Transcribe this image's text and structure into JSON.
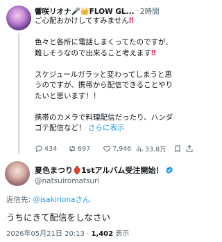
{
  "tweet1": {
    "author": "響咲リオナ🎤👑FLOW GL...",
    "dot": "·",
    "time": "2時間",
    "lines": [
      "ご心配おかけしてすみません",
      "",
      "色々と各所に電話しまくってたのですが、",
      "難しそうなので出来ること考えます",
      "",
      "スケジュールガラッと変わってしまうと思",
      "うのですが、携帯から配信できることやり",
      "たいと思います！！",
      "",
      "携帯のカメラで料理配信だったり、ハンダ",
      "ゴテ配信など！"
    ],
    "show_more": "さらに表示",
    "stats": {
      "replies": "434",
      "retweets": "697",
      "likes": "7,946",
      "views": "33.8万"
    }
  },
  "tweet2": {
    "author": "夏色まつり",
    "author_suffix": "1stアルバム受注開始！",
    "handle": "@natsuiromatsuri",
    "reply_prefix": "返信先: ",
    "reply_mention": "@isakirionaさん",
    "text": "うちにきて配信をしなさい",
    "timestamp": "2026年05月21日 20:13 · ",
    "views_count": "1,402",
    "views_label": " 表示"
  },
  "icons": {
    "reply": "reply-icon",
    "retweet": "retweet-icon",
    "like": "heart-icon",
    "views": "views-icon",
    "bookmark": "bookmark-icon",
    "share": "share-icon",
    "verified": "verified-badge-icon",
    "lantern": "lantern-icon",
    "exclamation": "double-exclamation-icon"
  },
  "colors": {
    "accent": "#1d9bf0",
    "muted": "#536471",
    "text": "#0f1419",
    "alert": "#e0245e"
  }
}
